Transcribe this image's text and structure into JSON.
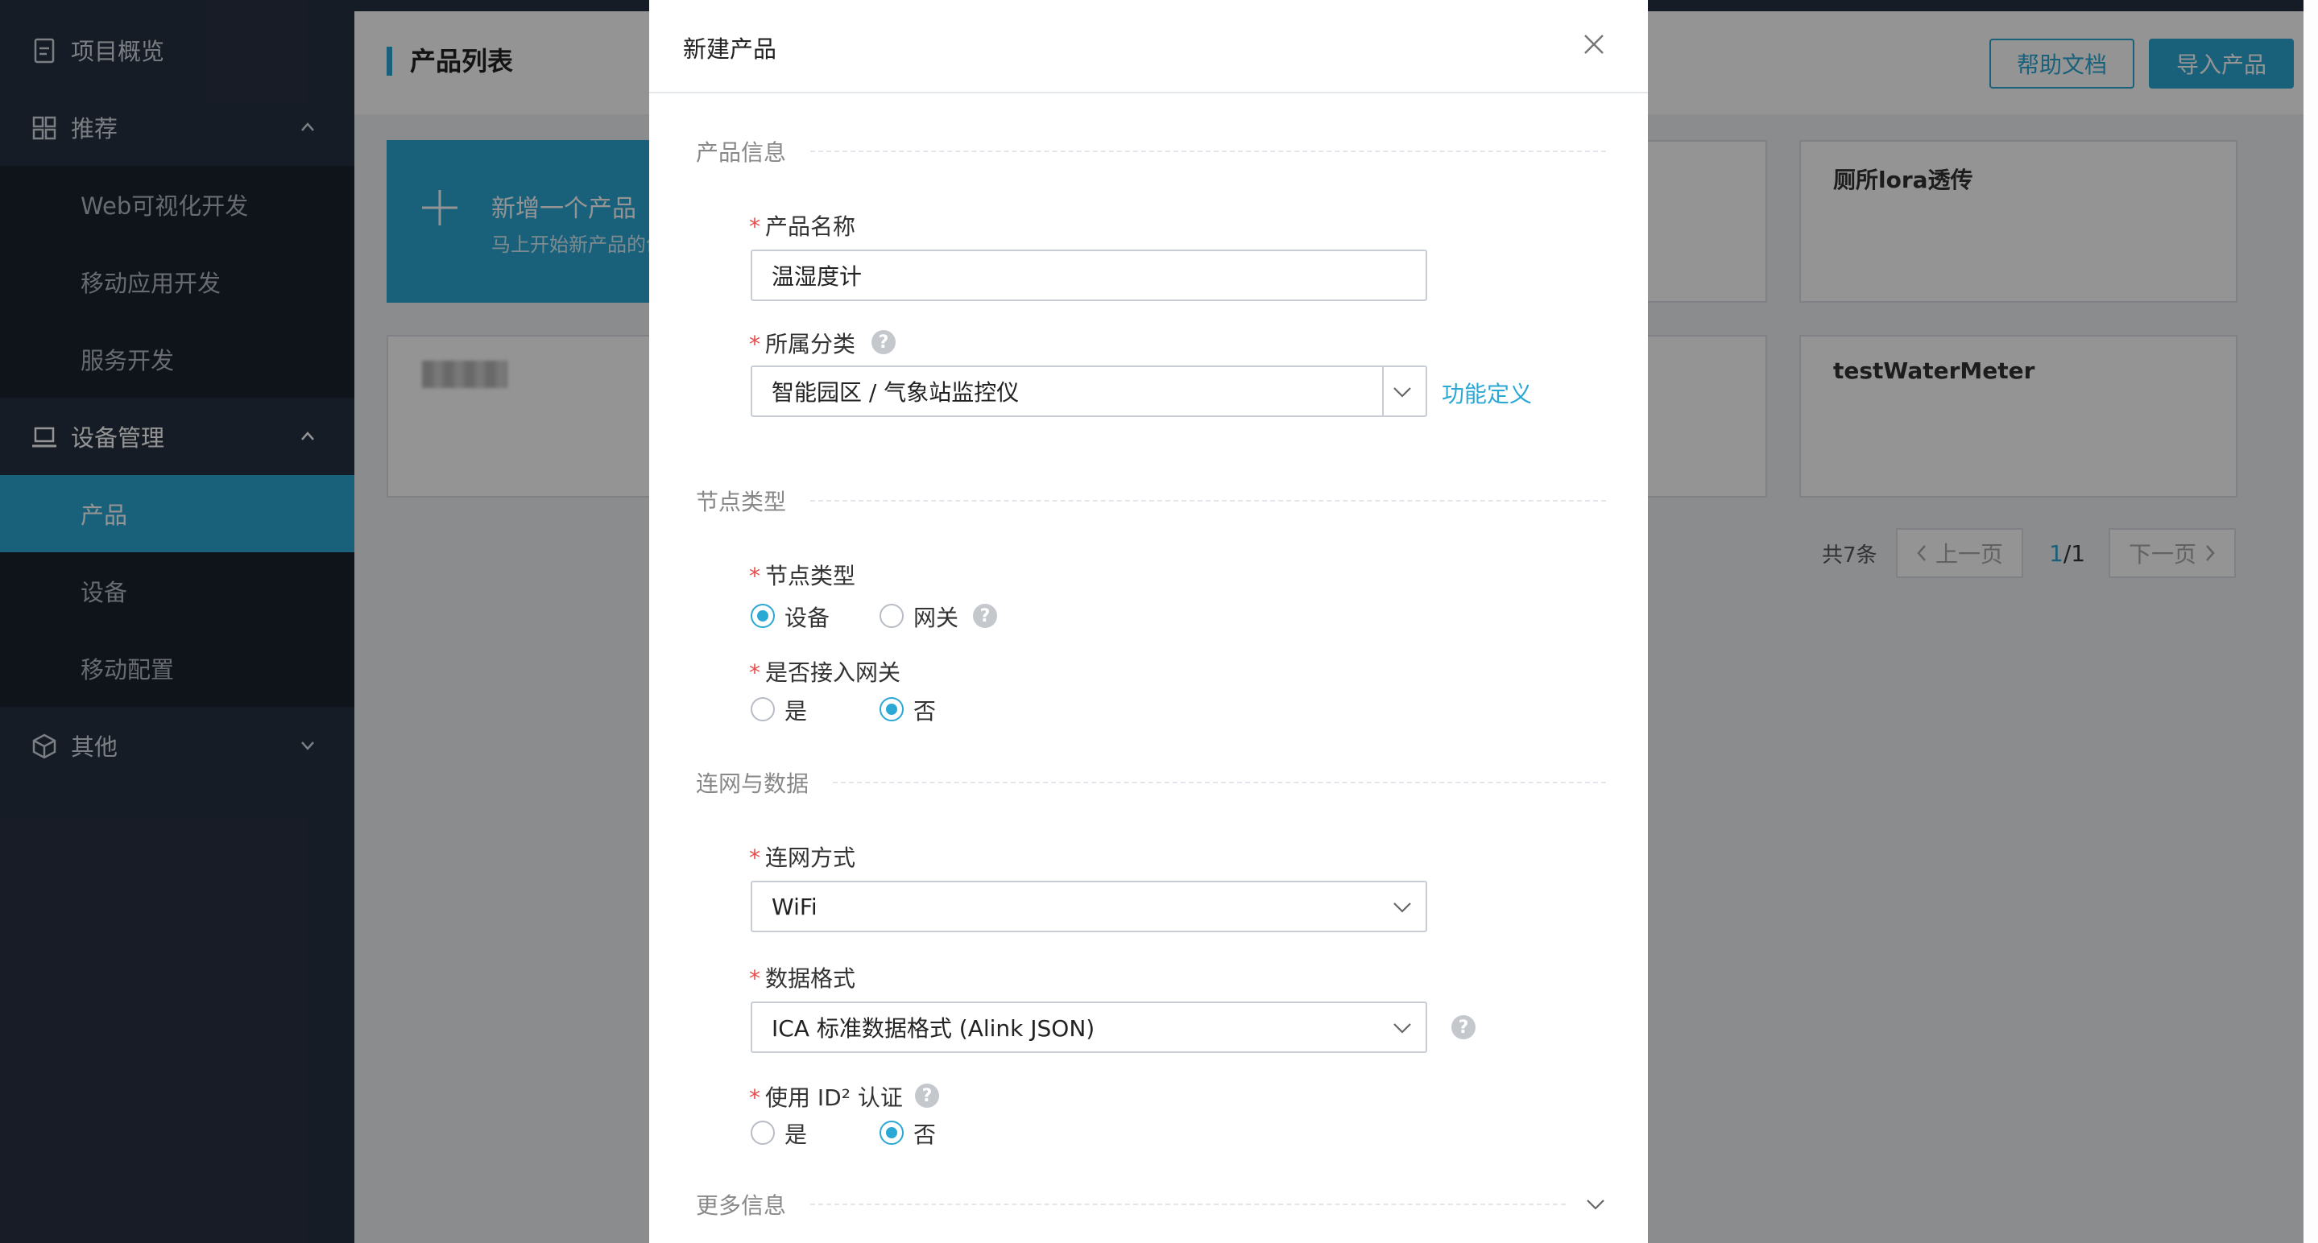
{
  "sidebar": {
    "items": [
      {
        "label": "项目概览",
        "icon": "document-icon"
      },
      {
        "label": "推荐",
        "icon": "grid-icon"
      },
      {
        "label": "Web可视化开发"
      },
      {
        "label": "移动应用开发"
      },
      {
        "label": "服务开发"
      },
      {
        "label": "设备管理",
        "icon": "laptop-icon"
      },
      {
        "label": "产品"
      },
      {
        "label": "设备"
      },
      {
        "label": "移动配置"
      },
      {
        "label": "其他",
        "icon": "cube-icon"
      }
    ]
  },
  "header": {
    "title": "产品列表",
    "help_button": "帮助文档",
    "import_button": "导入产品"
  },
  "new_product_card": {
    "title": "新增一个产品",
    "subtitle": "马上开始新产品的创建"
  },
  "product_cards": [
    {
      "name": "厕所lora透传"
    },
    {
      "name": "testWaterMeter"
    }
  ],
  "pagination": {
    "total": "共7条",
    "prev": "上一页",
    "current": "1",
    "separator": "/1",
    "next": "下一页"
  },
  "modal": {
    "title": "新建产品",
    "sections": {
      "product_info": "产品信息",
      "node_type": "节点类型",
      "network_data": "连网与数据",
      "more_info": "更多信息"
    },
    "fields": {
      "product_name": {
        "label": "产品名称",
        "value": "温湿度计"
      },
      "category": {
        "label": "所属分类",
        "value": "智能园区 / 气象站监控仪",
        "link": "功能定义"
      },
      "node_type": {
        "label": "节点类型",
        "options": [
          "设备",
          "网关"
        ],
        "selected": "设备"
      },
      "gateway": {
        "label": "是否接入网关",
        "options": [
          "是",
          "否"
        ],
        "selected": "否"
      },
      "network_method": {
        "label": "连网方式",
        "value": "WiFi"
      },
      "data_format": {
        "label": "数据格式",
        "value": "ICA 标准数据格式 (Alink JSON)"
      },
      "id2_auth": {
        "label": "使用 ID² 认证",
        "options": [
          "是",
          "否"
        ],
        "selected": "否"
      }
    }
  },
  "colors": {
    "accent": "#2ba8d4",
    "sidebar_bg": "#273142",
    "sidebar_sub_bg": "#1a222d",
    "required": "#e84b4b"
  }
}
